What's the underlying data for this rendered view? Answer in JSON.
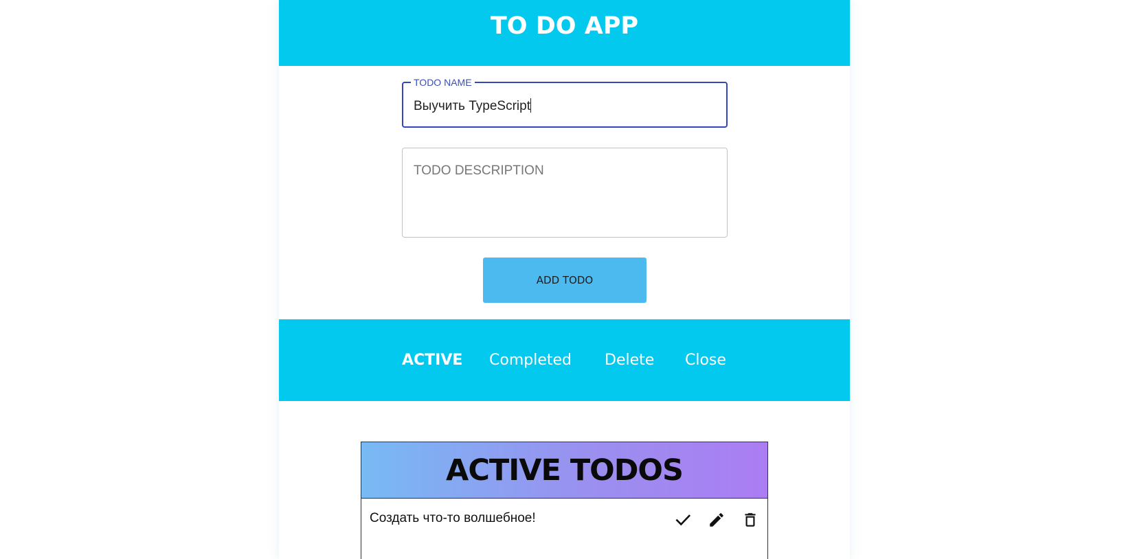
{
  "header": {
    "title": "TO DO APP"
  },
  "form": {
    "name_label": "TODO NAME",
    "name_value": "Выучить TypeScript",
    "description_placeholder": "TODO DESCRIPTION",
    "add_button_label": "ADD TODO"
  },
  "tabs": [
    {
      "label": "ACTIVE",
      "selected": true
    },
    {
      "label": "Completed",
      "selected": false
    },
    {
      "label": "Delete",
      "selected": false
    },
    {
      "label": "Close",
      "selected": false
    }
  ],
  "list": {
    "title": "ACTIVE TODOS",
    "items": [
      {
        "text": "Создать что-то волшебное!",
        "icons": [
          "check-icon",
          "pencil-icon",
          "trash-icon"
        ]
      }
    ]
  },
  "colors": {
    "accent": "#03c9ee",
    "button": "#4dbaef",
    "focus": "#3346b8",
    "gradient_start": "#77baf4",
    "gradient_end": "#ab7df2"
  }
}
